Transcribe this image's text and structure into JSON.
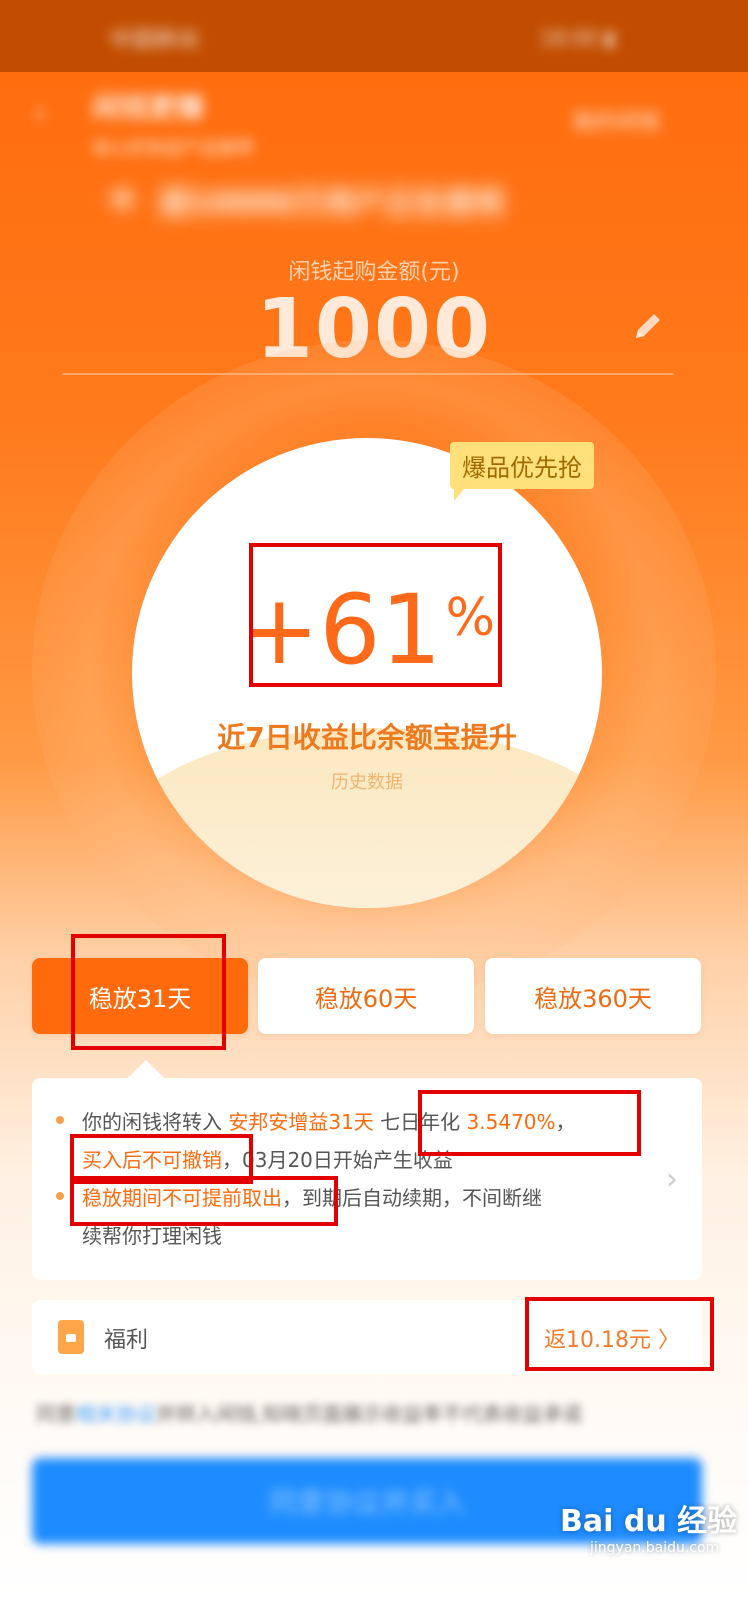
{
  "status_bar": {
    "left": "中国移动",
    "right": "18:00 ▮"
  },
  "header": {
    "title": "闲钱更赚",
    "subtitle": "省心好收益产品推荐",
    "right": "我的闲钱",
    "notice": "超10000万用户正在使用"
  },
  "amount": {
    "label": "闲钱起购金额(元)",
    "value": "1000"
  },
  "hero": {
    "tag": "爆品优先抢",
    "percent_number": "+61",
    "percent_unit": "%",
    "subtitle": "近7日收益比余额宝提升",
    "note": "历史数据"
  },
  "tabs": [
    {
      "label": "稳放31天",
      "active": true
    },
    {
      "label": "稳放60天",
      "active": false
    },
    {
      "label": "稳放360天",
      "active": false
    }
  ],
  "info": {
    "line1_prefix": "你的闲钱将转入 ",
    "product": "安邦安增益31天",
    "line1_mid": " 七日年化 ",
    "rate": "3.5470%",
    "line1_end": "，",
    "no_cancel": "买入后不可撤销",
    "line2_rest": "，03月20日开始产生收益",
    "no_withdraw": "稳放期间不可提前取出",
    "line3_rest": "，到期后自动续期，不间断继",
    "line4": "续帮你打理闲钱"
  },
  "welfare": {
    "label": "福利",
    "value": "返10.18元",
    "chevron": "〉"
  },
  "agreement": {
    "prefix": "同意",
    "link": "相关协议",
    "suffix": "并转入闲钱,知晓页面展示收益率不代表收益承诺"
  },
  "cta": {
    "label": "同意协议并买入"
  },
  "watermark": {
    "brand": "Bai du 经验",
    "url": "jingyan.baidu.com"
  },
  "colors": {
    "brand_orange": "#ff6a0c",
    "annotation_red": "#e30000",
    "cta_blue": "#1e8cff"
  }
}
